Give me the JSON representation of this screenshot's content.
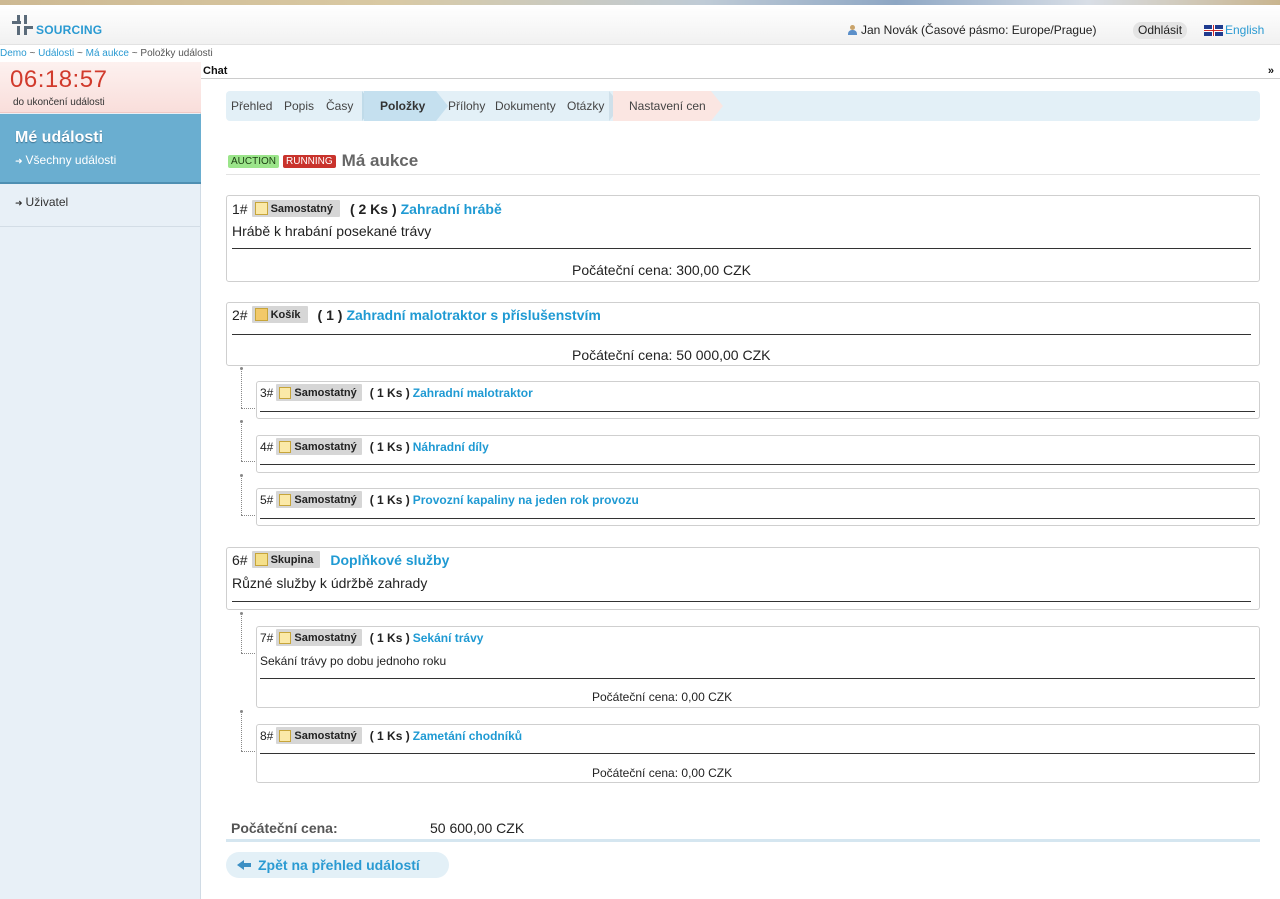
{
  "header": {
    "logo_text": "SOURCING",
    "user": "Jan Novák (Časové pásmo: Europe/Prague)",
    "logout": "Odhlásit",
    "language": "English"
  },
  "breadcrumb": [
    "Demo",
    "Události",
    "Má aukce",
    "Položky události"
  ],
  "sidebar": {
    "timer": "06:18:57",
    "timer_label": "do ukončení události",
    "my_events": "Mé události",
    "all_events": "Všechny události",
    "user": "Uživatel"
  },
  "chat": {
    "label": "Chat",
    "toggle": "»"
  },
  "tabs": [
    "Přehled",
    "Popis",
    "Časy",
    "Položky",
    "Přílohy",
    "Dokumenty",
    "Otázky",
    "Nastavení cen"
  ],
  "event": {
    "badge_type": "AUCTION",
    "badge_status": "RUNNING",
    "title": "Má aukce"
  },
  "items": [
    {
      "num": "1#",
      "type": "Samostatný",
      "qty": "( 2 Ks )",
      "name": "Zahradní hrábě",
      "desc": "Hrábě k hrabání posekané trávy",
      "price": "Počáteční cena: 300,00 CZK"
    },
    {
      "num": "2#",
      "type": "Košík",
      "qty": "( 1 )",
      "name": "Zahradní malotraktor s příslušenstvím",
      "price": "Počáteční cena: 50 000,00 CZK"
    },
    {
      "num": "3#",
      "type": "Samostatný",
      "qty": "( 1 Ks )",
      "name": "Zahradní malotraktor"
    },
    {
      "num": "4#",
      "type": "Samostatný",
      "qty": "( 1 Ks )",
      "name": "Náhradní díly"
    },
    {
      "num": "5#",
      "type": "Samostatný",
      "qty": "( 1 Ks )",
      "name": "Provozní kapaliny na jeden rok provozu"
    },
    {
      "num": "6#",
      "type": "Skupina",
      "name": "Doplňkové služby",
      "desc": "Různé služby k údržbě zahrady"
    },
    {
      "num": "7#",
      "type": "Samostatný",
      "qty": "( 1 Ks )",
      "name": "Sekání trávy",
      "desc": "Sekání trávy po dobu jednoho roku",
      "price": "Počáteční cena: 0,00 CZK"
    },
    {
      "num": "8#",
      "type": "Samostatný",
      "qty": "( 1 Ks )",
      "name": "Zametání chodníků",
      "price": "Počáteční cena: 0,00 CZK"
    }
  ],
  "total": {
    "label": "Počáteční cena:",
    "value": "50 600,00 CZK"
  },
  "back": "Zpět na přehled událostí",
  "colors": {
    "accent": "#2a9ad2",
    "timer": "#d13a2c",
    "sidebar_active": "#6aaed0"
  }
}
